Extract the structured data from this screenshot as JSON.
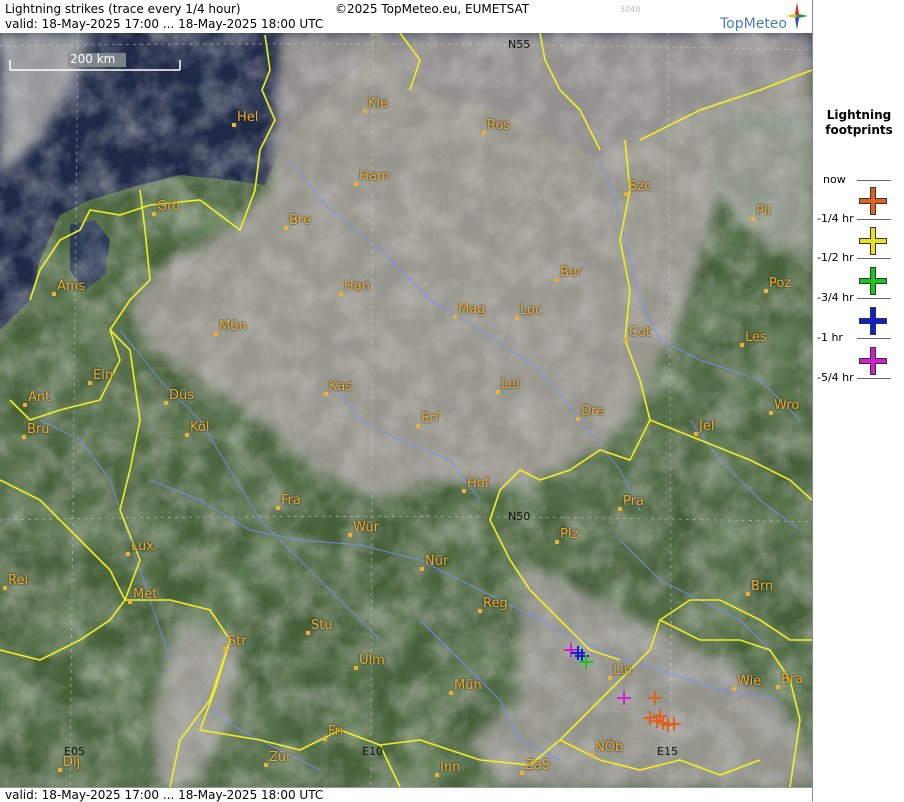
{
  "header": {
    "line1": "Lightning strikes (trace every 1/4 hour)",
    "line2": "valid:  18-May-2025 17:00 ... 18-May-2025 18:00 UTC",
    "copyright": "©2025 TopMeteo.eu, EUMETSAT",
    "code": "3040",
    "brand": "TopMeteo"
  },
  "footer": {
    "text": "valid:  18-May-2025 17:00 ... 18-May-2025 18:00 UTC"
  },
  "scale": {
    "label": "200 km"
  },
  "grid_labels": {
    "n55": "N55",
    "n50": "N50",
    "e05": "E05",
    "e10": "E10",
    "e15": "E15"
  },
  "cities": [
    "Hel",
    "Kie",
    "Ros",
    "Ham",
    "Gro",
    "Bre",
    "Szc",
    "Pil",
    "Ams",
    "Han",
    "Ber",
    "Mün",
    "Mag",
    "Loc",
    "Cot",
    "Poz",
    "Les",
    "Ein",
    "Kas",
    "Lei",
    "Ant",
    "Düs",
    "Köl",
    "Bru",
    "Erf",
    "Dre",
    "Wro",
    "Jel",
    "Hof",
    "Fra",
    "Pra",
    "Lux",
    "Wür",
    "Plz",
    "Rei",
    "Nür",
    "Met",
    "Reg",
    "Brn",
    "Stu",
    "Str",
    "Ulm",
    "Lin",
    "Mün",
    "Wie",
    "Bra",
    "Fri",
    "Dij",
    "Zür",
    "Inn",
    "ZaS",
    "NÖb"
  ],
  "legend": {
    "title_line1": "Lightning",
    "title_line2": "footprints",
    "items": [
      {
        "label": "now",
        "color": "#e0621e"
      },
      {
        "label": "-1/4 hr",
        "color": "#e8e020"
      },
      {
        "label": "-1/2 hr",
        "color": "#18c818"
      },
      {
        "label": "-3/4 hr",
        "color": "#1020d0"
      },
      {
        "label": "-1 hr",
        "color": "#d020d0"
      },
      {
        "label": "-5/4 hr",
        "color": ""
      }
    ]
  },
  "colors": {
    "border": "#f0f020",
    "river": "#7c8cff",
    "city_label": "#f0b030",
    "sea": "#1e2a48",
    "land": "#3e5e34",
    "cloud": "#9c9c98"
  }
}
